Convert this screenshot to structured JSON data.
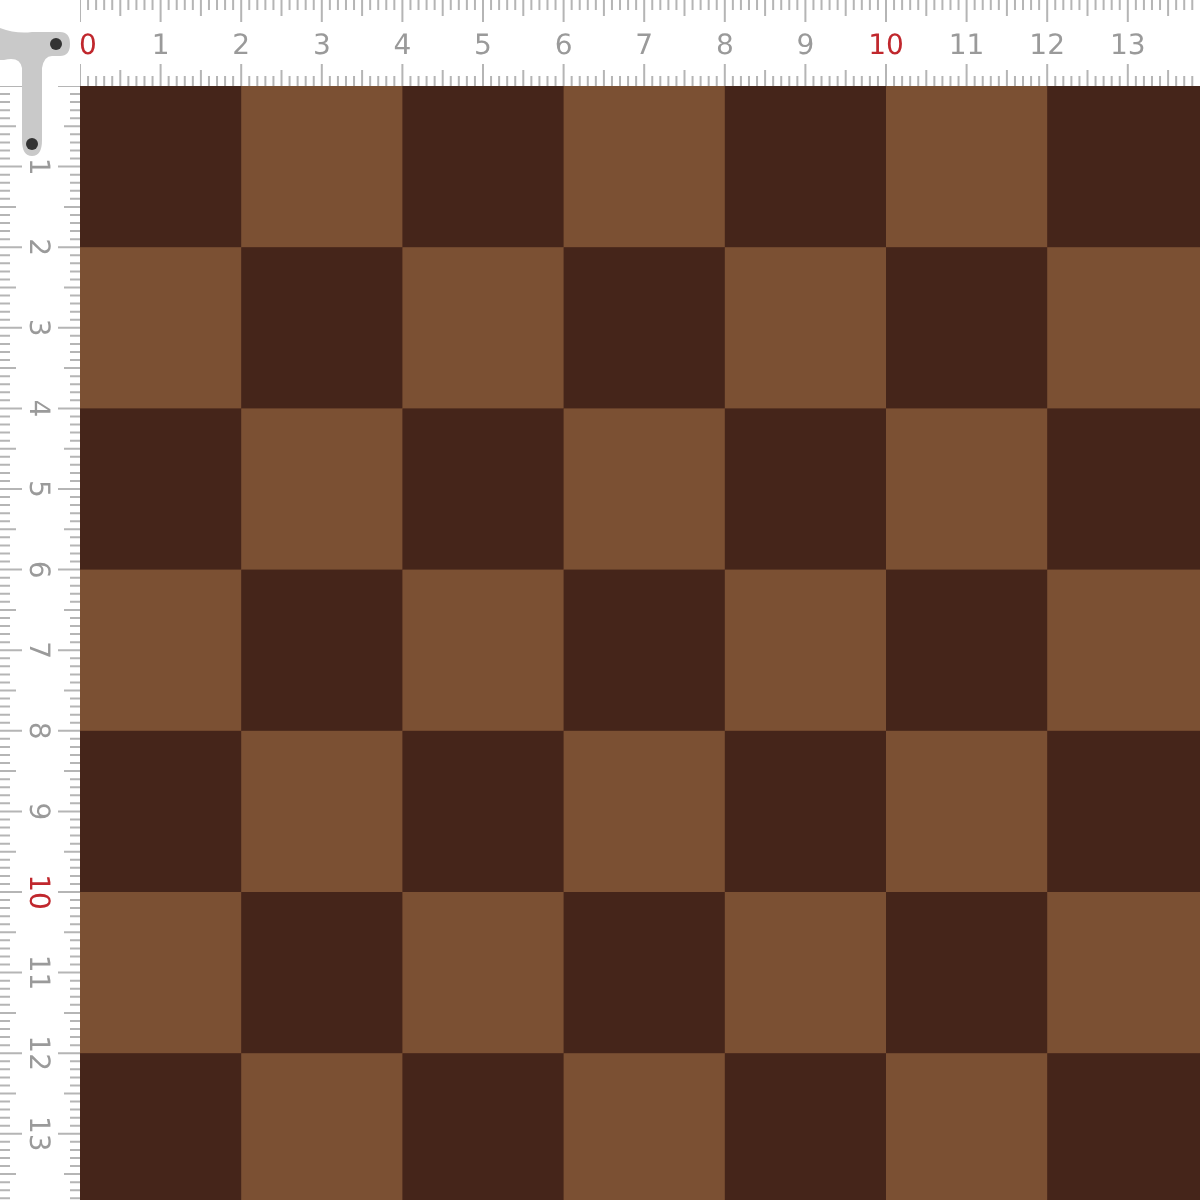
{
  "top_ruler": {
    "labels": [
      {
        "text": "0",
        "color": "#c0272d"
      },
      {
        "text": "1",
        "color": "#9a9a9a"
      },
      {
        "text": "2",
        "color": "#9a9a9a"
      },
      {
        "text": "3",
        "color": "#9a9a9a"
      },
      {
        "text": "4",
        "color": "#9a9a9a"
      },
      {
        "text": "5",
        "color": "#9a9a9a"
      },
      {
        "text": "6",
        "color": "#9a9a9a"
      },
      {
        "text": "7",
        "color": "#9a9a9a"
      },
      {
        "text": "8",
        "color": "#9a9a9a"
      },
      {
        "text": "9",
        "color": "#9a9a9a"
      },
      {
        "text": "10",
        "color": "#c0272d"
      },
      {
        "text": "11",
        "color": "#9a9a9a"
      },
      {
        "text": "12",
        "color": "#9a9a9a"
      },
      {
        "text": "13",
        "color": "#9a9a9a"
      }
    ]
  },
  "left_ruler": {
    "labels": [
      {
        "text": "1",
        "color": "#9a9a9a"
      },
      {
        "text": "2",
        "color": "#9a9a9a"
      },
      {
        "text": "3",
        "color": "#9a9a9a"
      },
      {
        "text": "4",
        "color": "#9a9a9a"
      },
      {
        "text": "5",
        "color": "#9a9a9a"
      },
      {
        "text": "6",
        "color": "#9a9a9a"
      },
      {
        "text": "7",
        "color": "#9a9a9a"
      },
      {
        "text": "8",
        "color": "#9a9a9a"
      },
      {
        "text": "9",
        "color": "#9a9a9a"
      },
      {
        "text": "10",
        "color": "#c0272d"
      },
      {
        "text": "11",
        "color": "#9a9a9a"
      },
      {
        "text": "12",
        "color": "#9a9a9a"
      },
      {
        "text": "13",
        "color": "#9a9a9a"
      }
    ]
  },
  "pattern": {
    "kind": "checkerboard"
  }
}
